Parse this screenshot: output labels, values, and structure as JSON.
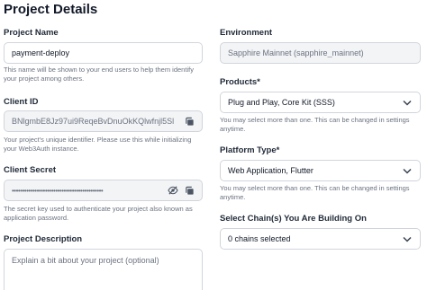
{
  "page": {
    "title": "Project Details"
  },
  "left": {
    "project_name": {
      "label": "Project Name",
      "value": "payment-deploy",
      "help": "This name will be shown to your end users to help them identify your project among others."
    },
    "client_id": {
      "label": "Client ID",
      "value": "BNlgmbE8Jz97ui9ReqeBvDnuOkKQlwfnjl5Sl",
      "help": "Your project's unique identifier. Please use this while initializing your Web3Auth instance."
    },
    "client_secret": {
      "label": "Client Secret",
      "value": "••••••••••••••••••••••••••••••••••••••••••••",
      "help": "The secret key used to authenticate your project also known as application password."
    },
    "description": {
      "label": "Project Description",
      "placeholder": "Explain a bit about your project (optional)"
    }
  },
  "right": {
    "environment": {
      "label": "Environment",
      "value": "Sapphire Mainnet (sapphire_mainnet)"
    },
    "products": {
      "label": "Products*",
      "value": "Plug and Play, Core Kit (SSS)",
      "help": "You may select more than one. This can be changed in settings anytime."
    },
    "platform": {
      "label": "Platform Type*",
      "value": "Web Application, Flutter",
      "help": "You may select more than one. This can be changed in settings anytime."
    },
    "chains": {
      "label": "Select Chain(s) You Are Building On",
      "value": "0 chains selected"
    }
  },
  "icons": {
    "copy": "copy-icon",
    "eye_off": "eye-off-icon",
    "chevron": "chevron-down-icon"
  }
}
